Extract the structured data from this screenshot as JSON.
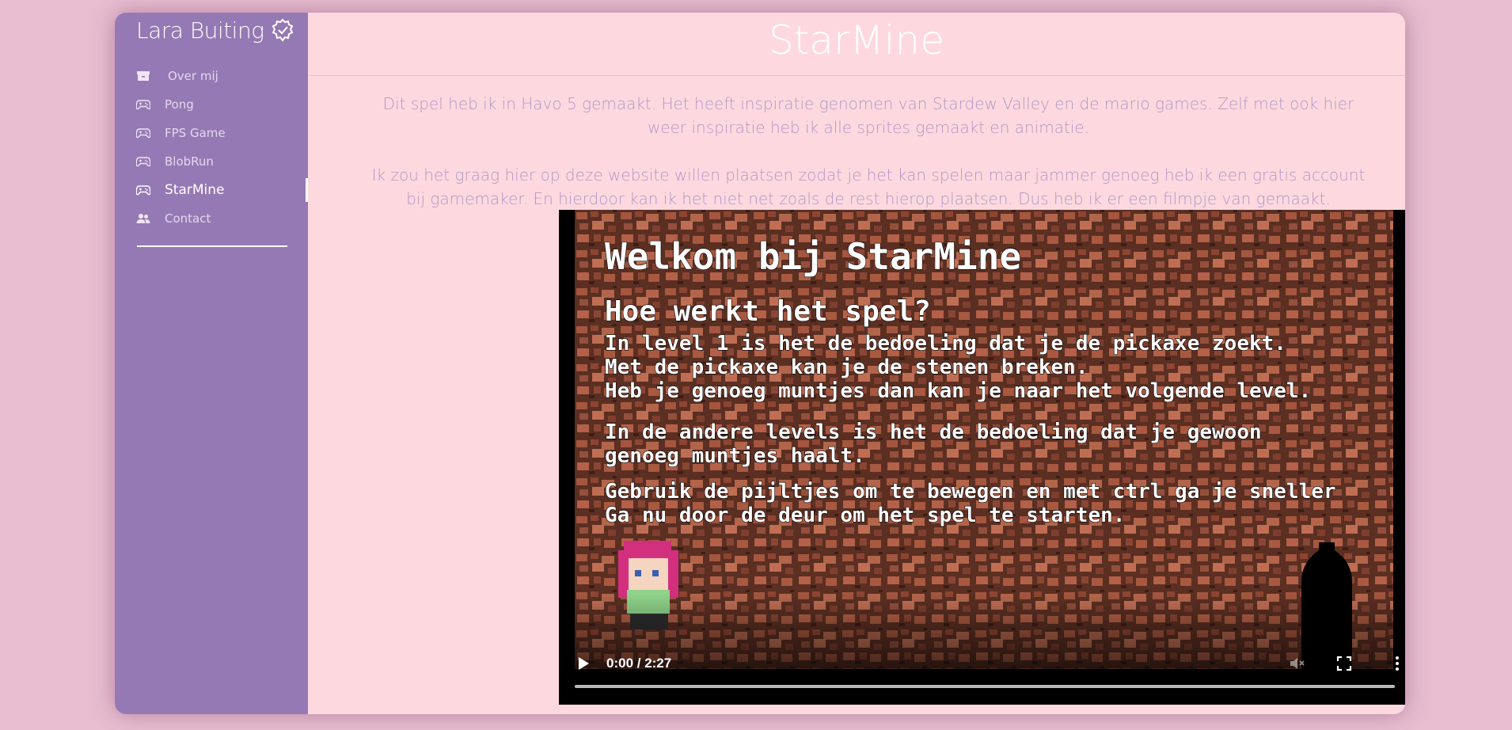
{
  "brand": {
    "name": "Lara Buiting",
    "icon": "verified-badge-icon"
  },
  "sidebar": {
    "items": [
      {
        "label": "Over mij",
        "icon": "archive-icon",
        "active": false
      },
      {
        "label": "Pong",
        "icon": "gamepad-icon",
        "active": false
      },
      {
        "label": "FPS Game",
        "icon": "gamepad-icon",
        "active": false
      },
      {
        "label": "BlobRun",
        "icon": "gamepad-icon",
        "active": false
      },
      {
        "label": "StarMine",
        "icon": "gamepad-icon",
        "active": true
      },
      {
        "label": "Contact",
        "icon": "users-icon",
        "active": false
      }
    ]
  },
  "main": {
    "title": "StarMine",
    "paragraph1": "Dit spel heb ik in Havo 5 gemaakt. Het heeft inspiratie genomen van Stardew Valley en de mario games. Zelf met ook hier weer inspiratie heb ik alle sprites gemaakt en animatie.",
    "paragraph2": "Ik zou het graag hier op deze website willen plaatsen zodat je het kan spelen maar jammer genoeg heb ik een gratis account bij gamemaker. En hierdoor kan ik het niet net zoals de rest hierop plaatsen. Dus heb ik er een filmpje van gemaakt."
  },
  "video": {
    "time": "0:00 / 2:27",
    "progress": 0,
    "frame": {
      "heading": "Welkom bij StarMine",
      "subheading": "Hoe werkt het spel?",
      "lines": [
        "In level 1 is het de bedoeling dat je de pickaxe zoekt.",
        "Met de pickaxe kan je de stenen breken.",
        "Heb je genoeg muntjes dan kan je naar het volgende level.",
        "In de andere levels is het de bedoeling dat je gewoon",
        "genoeg muntjes haalt.",
        "Gebruik de pijltjes om te bewegen en met ctrl ga je sneller",
        "Ga nu door de deur om het spel te starten."
      ]
    }
  },
  "colors": {
    "page_bg": "#e8bdd0",
    "sidebar_bg": "#9579b4",
    "main_bg": "#fdd9df",
    "text_muted": "#b197c4"
  }
}
